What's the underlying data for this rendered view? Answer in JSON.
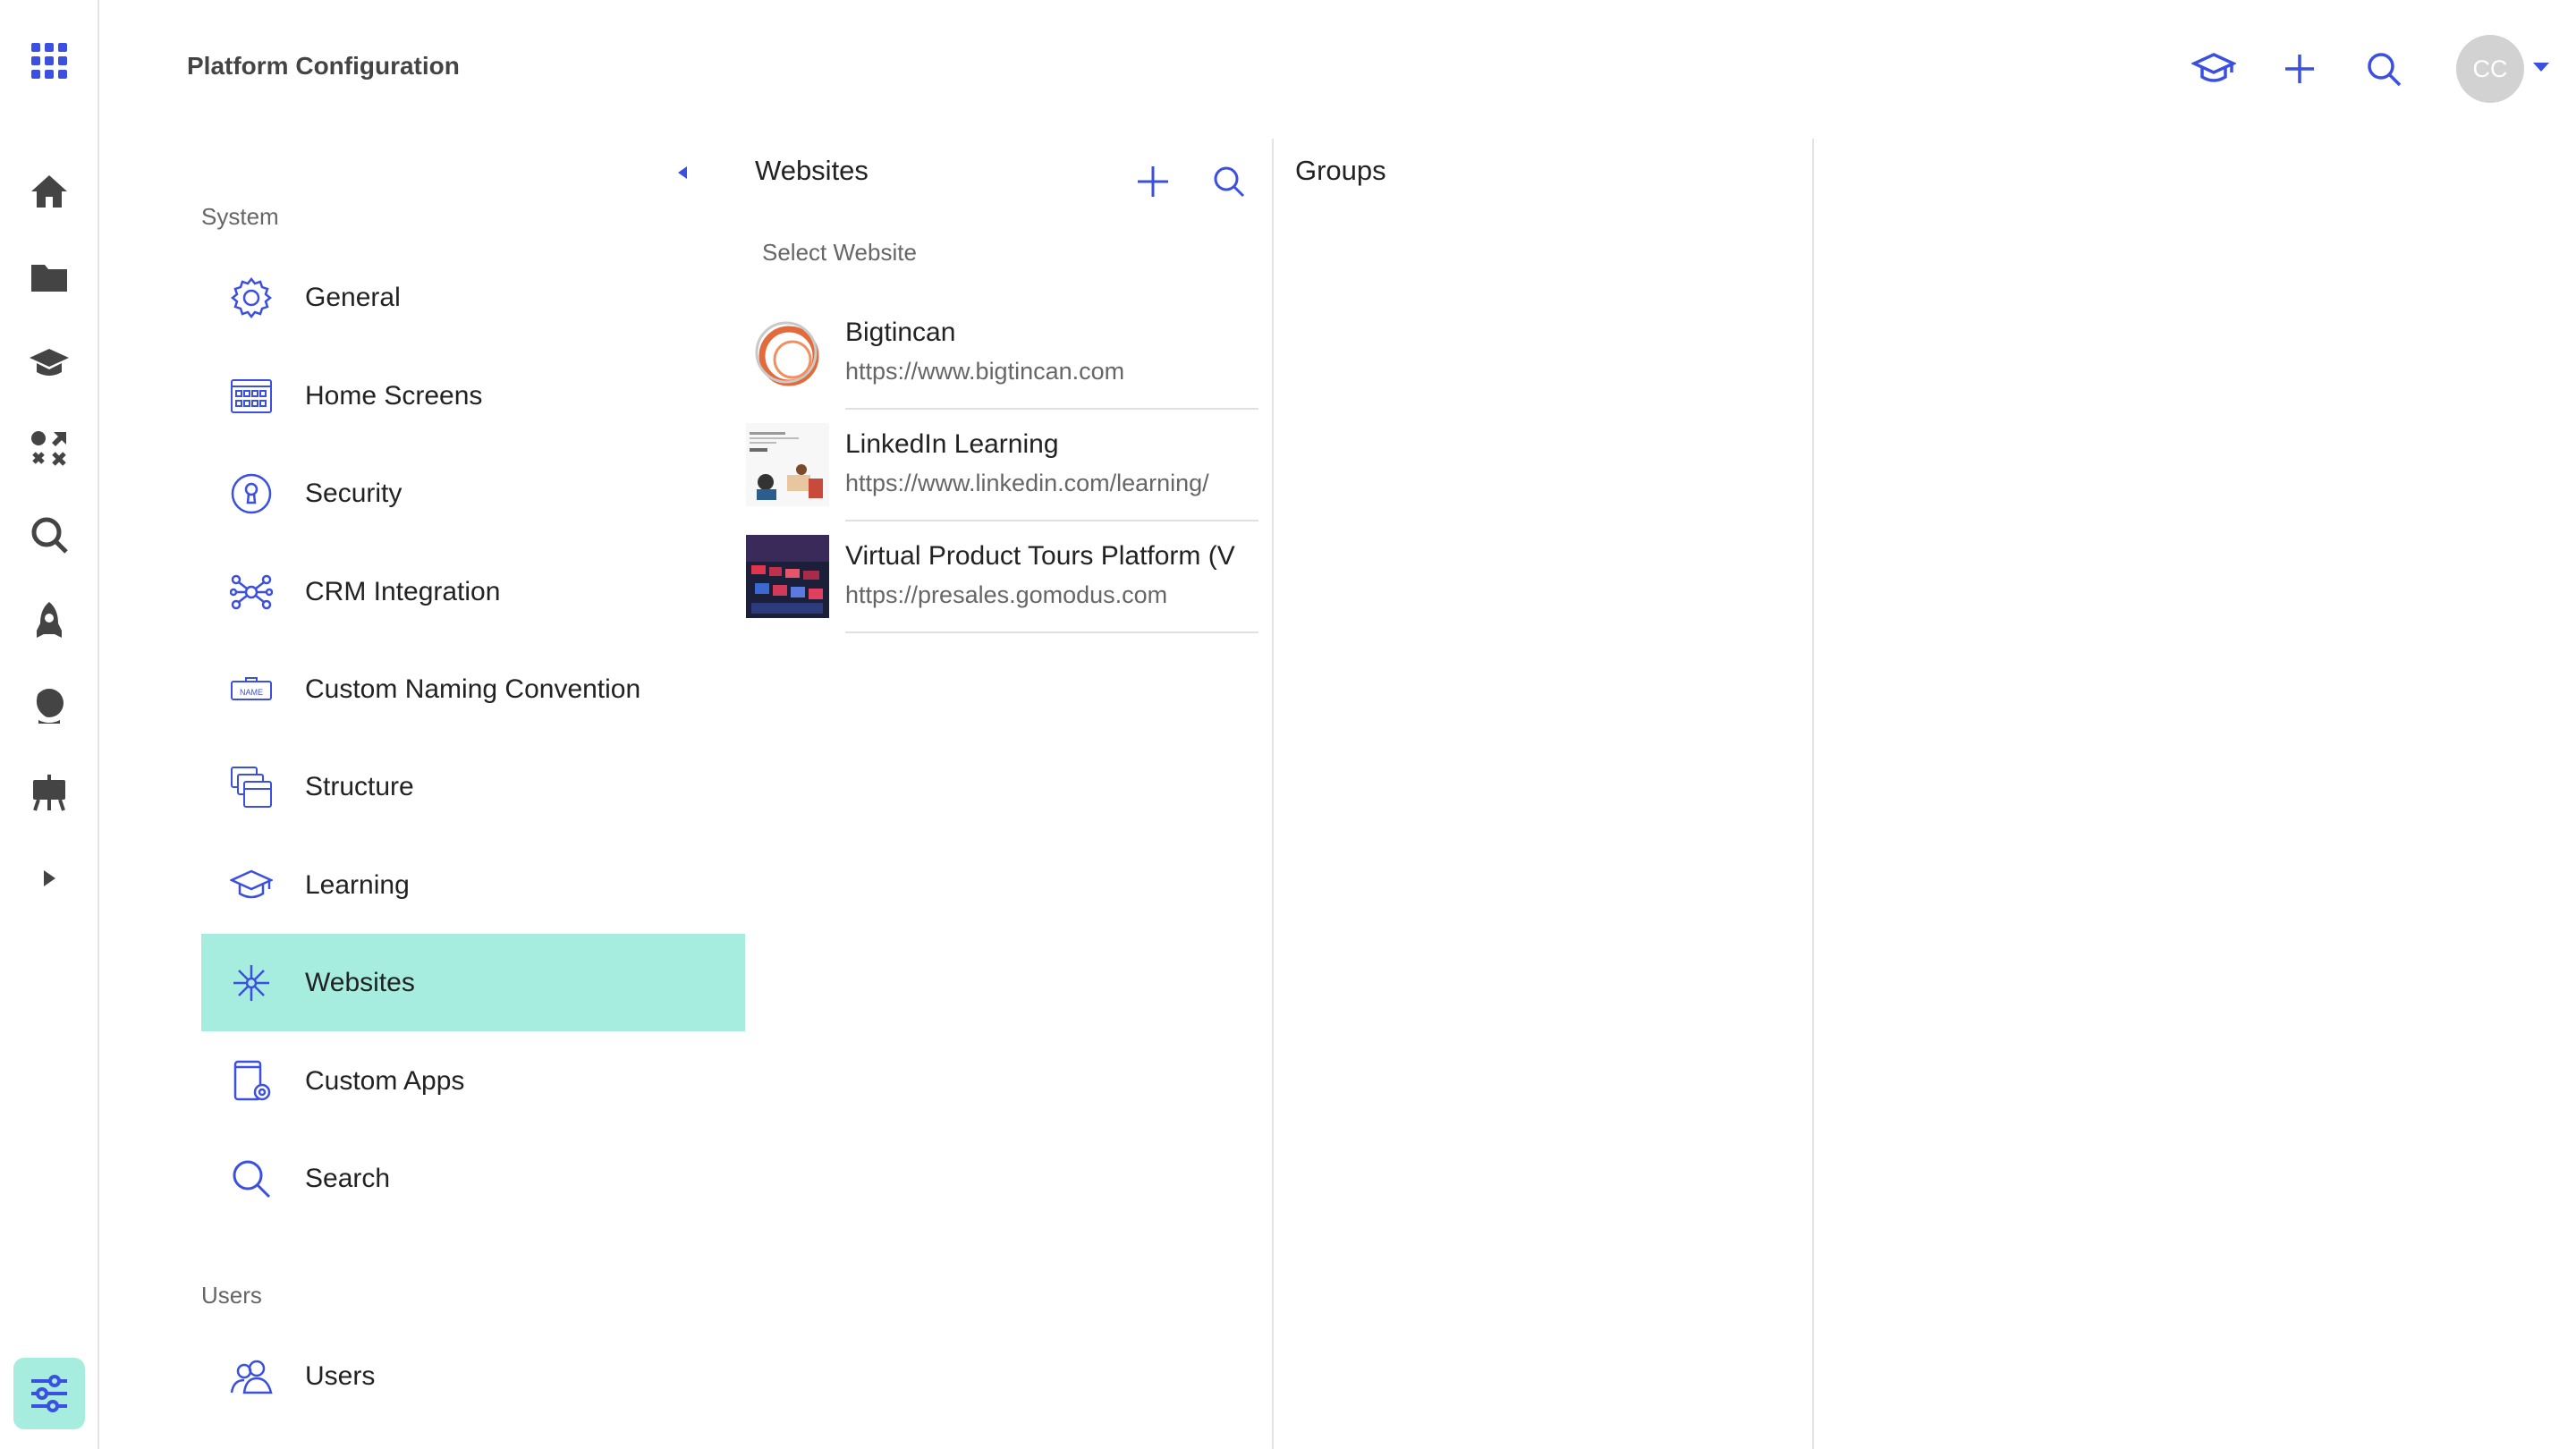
{
  "app": {
    "title": "Platform Configuration"
  },
  "colors": {
    "accent": "#3b4fe0",
    "active_bg": "#a6ede0",
    "divider": "#e4e4e4"
  },
  "rail": {
    "items": [
      {
        "icon": "apps-grid-icon"
      },
      {
        "icon": "home-icon"
      },
      {
        "icon": "folder-icon"
      },
      {
        "icon": "graduation-cap-icon"
      },
      {
        "icon": "shuffle-tools-icon"
      },
      {
        "icon": "search-icon"
      },
      {
        "icon": "rocket-icon"
      },
      {
        "icon": "globe-icon"
      },
      {
        "icon": "presentation-icon"
      },
      {
        "icon": "expand-arrow-icon"
      },
      {
        "icon": "settings-sliders-icon",
        "active": true
      }
    ]
  },
  "header": {
    "actions": [
      "learning-icon",
      "add-icon",
      "search-icon"
    ],
    "avatar_initials": "CC"
  },
  "nav": {
    "system_heading": "System",
    "users_heading": "Users",
    "items": [
      {
        "label": "General",
        "icon": "gear-icon"
      },
      {
        "label": "Home Screens",
        "icon": "home-screens-icon"
      },
      {
        "label": "Security",
        "icon": "lock-icon"
      },
      {
        "label": "CRM Integration",
        "icon": "network-icon"
      },
      {
        "label": "Custom Naming Convention",
        "icon": "name-tag-icon"
      },
      {
        "label": "Structure",
        "icon": "structure-icon"
      },
      {
        "label": "Learning",
        "icon": "graduation-cap-icon"
      },
      {
        "label": "Websites",
        "icon": "websites-icon",
        "active": true
      },
      {
        "label": "Custom Apps",
        "icon": "custom-apps-icon"
      },
      {
        "label": "Search",
        "icon": "search-icon"
      }
    ],
    "users_items": [
      {
        "label": "Users",
        "icon": "users-icon"
      }
    ]
  },
  "websites": {
    "title": "Websites",
    "select_label": "Select Website",
    "list": [
      {
        "name": "Bigtincan",
        "url": "https://www.bigtincan.com"
      },
      {
        "name": "LinkedIn Learning",
        "url": "https://www.linkedin.com/learning/"
      },
      {
        "name": "Virtual Product Tours Platform (V",
        "url": "https://presales.gomodus.com"
      }
    ]
  },
  "groups": {
    "title": "Groups"
  }
}
